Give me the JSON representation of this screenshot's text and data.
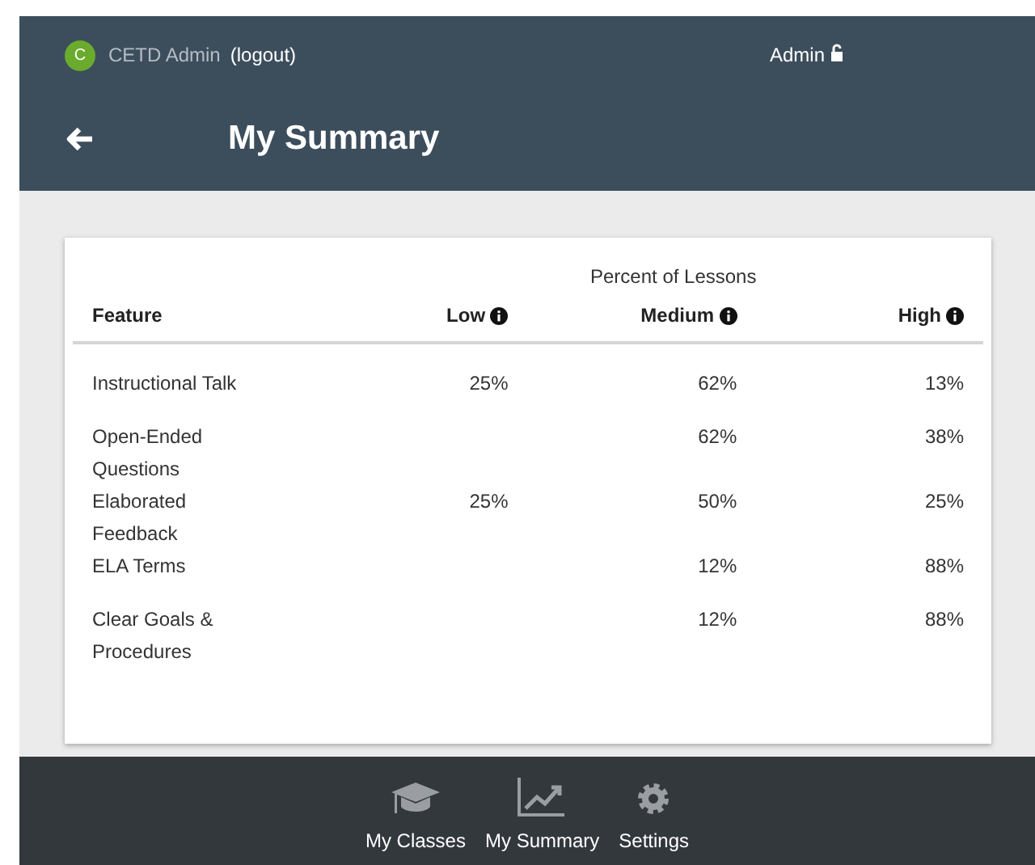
{
  "header": {
    "avatar": "C",
    "user": "CETD Admin",
    "logout": "(logout)",
    "role": "Admin",
    "title": "My Summary"
  },
  "table": {
    "group_heading": "Percent of Lessons",
    "columns": [
      "Feature",
      "Low",
      "Medium",
      "High"
    ],
    "rows": [
      {
        "feature": "Instructional Talk",
        "low": "25%",
        "medium": "62%",
        "high": "13%"
      },
      {
        "feature": "Open-Ended Questions",
        "medium": "62%",
        "high": "38%"
      },
      {
        "feature": "Elaborated Feedback",
        "low": "25%",
        "medium": "50%",
        "high": "25%"
      },
      {
        "feature": "ELA Terms",
        "medium": "12%",
        "high": "88%"
      },
      {
        "feature": "Clear Goals & Procedures",
        "medium": "12%",
        "high": "88%"
      }
    ]
  },
  "nav": [
    {
      "kind": "classes",
      "label": "My Classes"
    },
    {
      "kind": "summary",
      "label": "My Summary"
    },
    {
      "kind": "settings",
      "label": "Settings"
    }
  ]
}
